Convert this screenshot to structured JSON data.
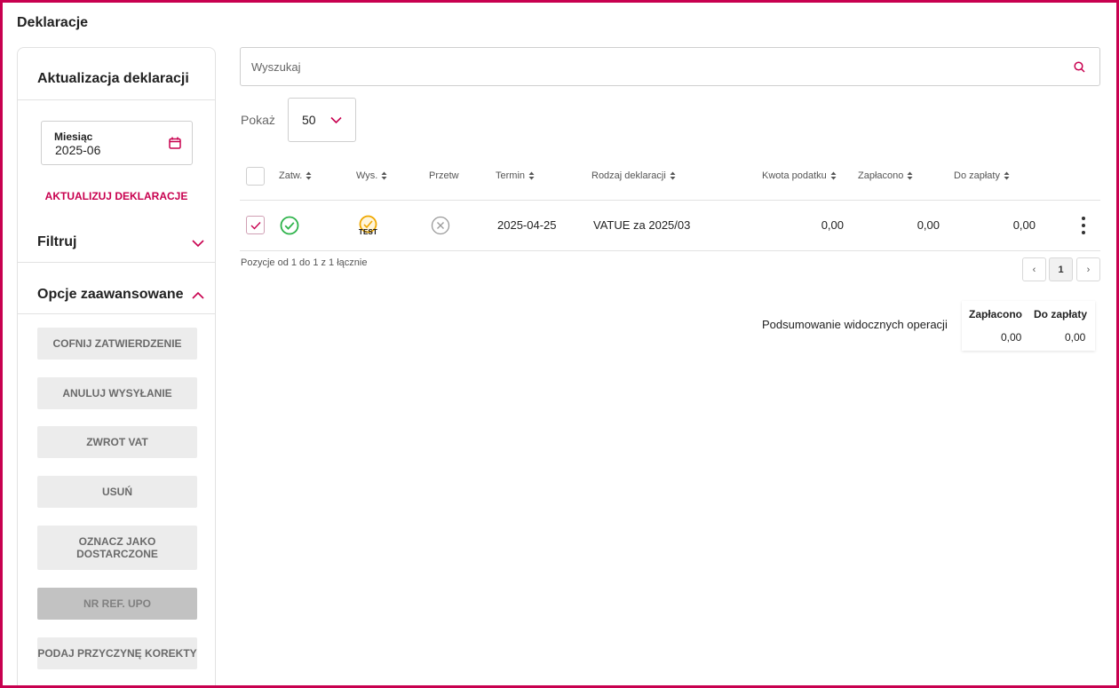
{
  "page": {
    "title": "Deklaracje"
  },
  "sidebar": {
    "update_title": "Aktualizacja deklaracji",
    "month_label": "Miesiąc",
    "month_value": "2025-06",
    "update_action": "AKTUALIZUJ DEKLARACJE",
    "filter_title": "Filtruj",
    "advanced_title": "Opcje zaawansowane",
    "buttons": [
      "COFNIJ ZATWIERDZENIE",
      "ANULUJ WYSYŁANIE",
      "ZWROT VAT",
      "USUŃ",
      "OZNACZ JAKO DOSTARCZONE",
      "NR REF. UPO",
      "PODAJ PRZYCZYNĘ KOREKTY"
    ]
  },
  "search": {
    "placeholder": "Wyszukaj"
  },
  "show": {
    "label": "Pokaż",
    "value": "50"
  },
  "table": {
    "headers": {
      "approved": "Zatw.",
      "sent": "Wys.",
      "processed": "Przetw",
      "deadline": "Termin",
      "declaration_type": "Rodzaj deklaracji",
      "tax_amount": "Kwota podatku",
      "paid": "Zapłacono",
      "to_pay": "Do zapłaty"
    },
    "rows": [
      {
        "sent_badge": "TEST",
        "deadline": "2025-04-25",
        "declaration_type": "VATUE za 2025/03",
        "tax_amount": "0,00",
        "paid": "0,00",
        "to_pay": "0,00"
      }
    ]
  },
  "pagination": {
    "info": "Pozycje od 1 do 1 z 1 łącznie",
    "prev": "‹",
    "page": "1",
    "next": "›"
  },
  "summary": {
    "label": "Podsumowanie widocznych operacji",
    "paid_header": "Zapłacono",
    "to_pay_header": "Do zapłaty",
    "paid_value": "0,00",
    "to_pay_value": "0,00"
  },
  "colors": {
    "accent": "#c8004f",
    "approved": "#2db34a",
    "test_badge": "#f0a800"
  }
}
